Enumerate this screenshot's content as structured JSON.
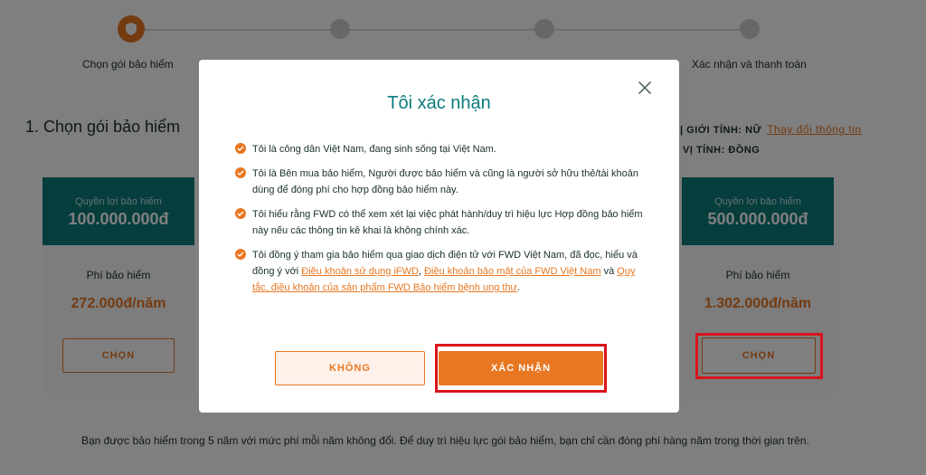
{
  "stepper": {
    "steps": [
      {
        "label": "Chọn gói bảo hiểm",
        "status": "active",
        "icon": "shield-icon"
      },
      {
        "label": "",
        "status": "inactive"
      },
      {
        "label": "",
        "status": "inactive"
      },
      {
        "label": "Xác nhận và thanh toán",
        "status": "inactive"
      }
    ]
  },
  "section": {
    "title": "1. Chọn gói bảo hiểm",
    "gender_info": "| GIỚI TÍNH: NỮ",
    "change_info_link": "Thay đổi thông tin",
    "currency_info": "VỊ TÍNH: ĐỒNG"
  },
  "plans": [
    {
      "benefit_label": "Quyền lợi bảo hiểm",
      "benefit_amount": "100.000.000đ",
      "premium_label": "Phí bảo hiểm",
      "premium": "272.000đ/năm",
      "button": "CHỌN"
    },
    {
      "benefit_label": "Quyền lợi bảo hiểm",
      "benefit_amount": "500.000.000đ",
      "premium_label": "Phí bảo hiểm",
      "premium": "1.302.000đ/năm",
      "button": "CHỌN",
      "highlighted": true
    }
  ],
  "footer_note": "Bạn được bảo hiểm trong 5 năm với mức phí mỗi năm không đổi. Để duy trì hiệu lực gói bảo hiểm, bạn chỉ cần đóng phí hàng năm trong thời gian trên.",
  "modal": {
    "title": "Tôi xác nhận",
    "close_icon": "close-icon",
    "statements": [
      {
        "text": "Tôi là công dân Việt Nam, đang sinh sống tại Việt Nam."
      },
      {
        "text": "Tôi là Bên mua bảo hiểm, Người được bảo hiểm và cũng là người sở hữu thẻ/tài khoản dùng để đóng phí cho hợp đồng bảo hiểm này."
      },
      {
        "text": "Tôi hiểu rằng FWD có thể xem xét lại việc phát hành/duy trì hiệu lực Hợp đồng bảo hiểm này nếu các thông tin kê khai là không chính xác."
      },
      {
        "text_before": "Tôi đồng ý tham gia bảo hiểm qua giao dịch điện tử với FWD Việt Nam, đã đọc, hiểu và đồng ý với ",
        "link1": "Điều khoản sử dụng iFWD",
        "sep1": ", ",
        "link2": "Điều khoản bảo mật của FWD Việt Nam",
        "sep2": " và ",
        "link3": "Quy tắc, điều khoản của sản phẩm FWD Bảo hiểm bệnh ung thư",
        "text_after": "."
      }
    ],
    "no_button": "KHÔNG",
    "confirm_button": "XÁC NHẬN"
  },
  "colors": {
    "accent": "#e87722",
    "teal": "#0d7b7b",
    "highlight": "#d9141c",
    "overlay": "rgba(0,0,0,0.5)"
  }
}
